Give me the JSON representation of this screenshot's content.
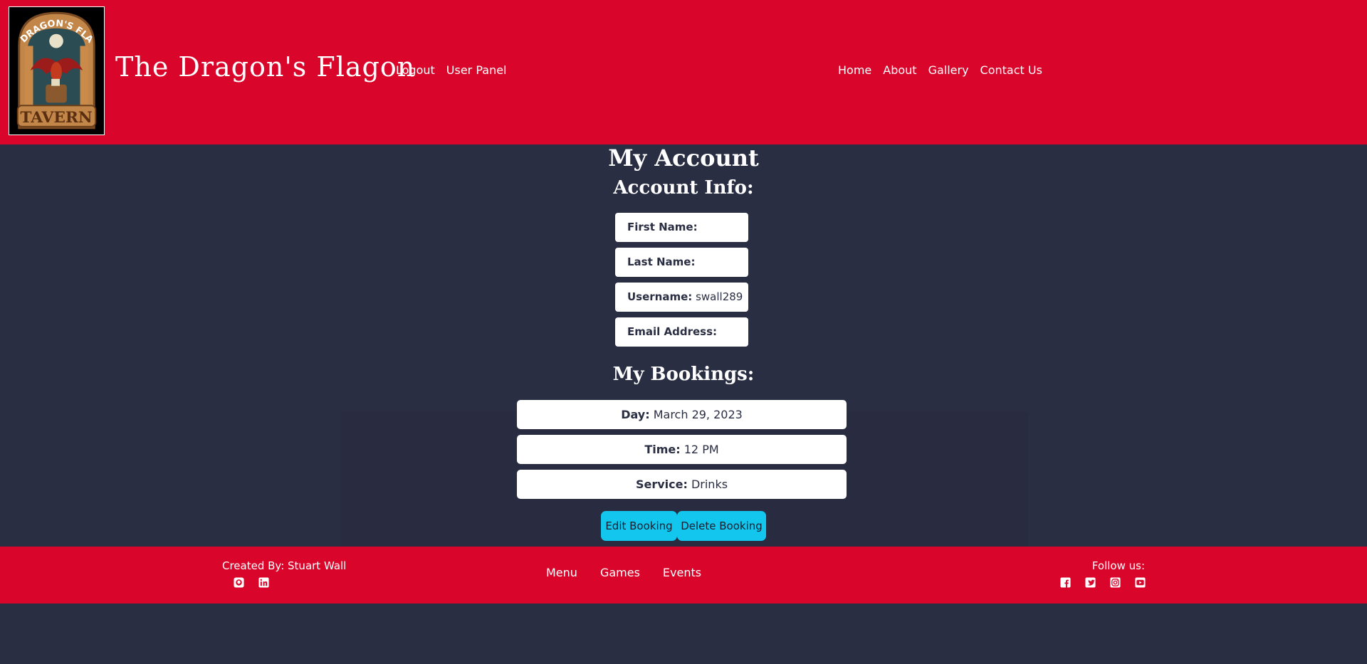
{
  "header": {
    "logo_text_top": "THE DRAGON'S FLAGON",
    "logo_text_bottom": "TAVERN",
    "site_title": "The Dragon's Flagon",
    "nav_left": [
      "Logout",
      "User Panel"
    ],
    "nav_right": [
      "Home",
      "About",
      "Gallery",
      "Contact Us"
    ]
  },
  "main": {
    "page_title": "My Account",
    "account_info_title": "Account Info:",
    "account_fields": [
      {
        "label": "First Name:",
        "value": ""
      },
      {
        "label": "Last Name:",
        "value": ""
      },
      {
        "label": "Username:",
        "value": "swall289"
      },
      {
        "label": "Email Address:",
        "value": ""
      }
    ],
    "bookings_title": "My Bookings:",
    "booking_fields": [
      {
        "label": "Day:",
        "value": "March 29, 2023"
      },
      {
        "label": "Time:",
        "value": "12 PM"
      },
      {
        "label": "Service:",
        "value": "Drinks"
      }
    ],
    "edit_button": "Edit Booking",
    "delete_button": "Delete Booking"
  },
  "footer": {
    "created_by": "Created By: Stuart Wall",
    "nav": [
      "Menu",
      "Games",
      "Events"
    ],
    "follow_us": "Follow us:",
    "social_left_icons": [
      "github-icon",
      "linkedin-icon"
    ],
    "social_right_icons": [
      "facebook-icon",
      "twitter-icon",
      "instagram-icon",
      "youtube-icon"
    ]
  },
  "colors": {
    "header_bg": "#da052a",
    "body_bg": "#2a2e43",
    "button_bg": "#12c6ee"
  }
}
